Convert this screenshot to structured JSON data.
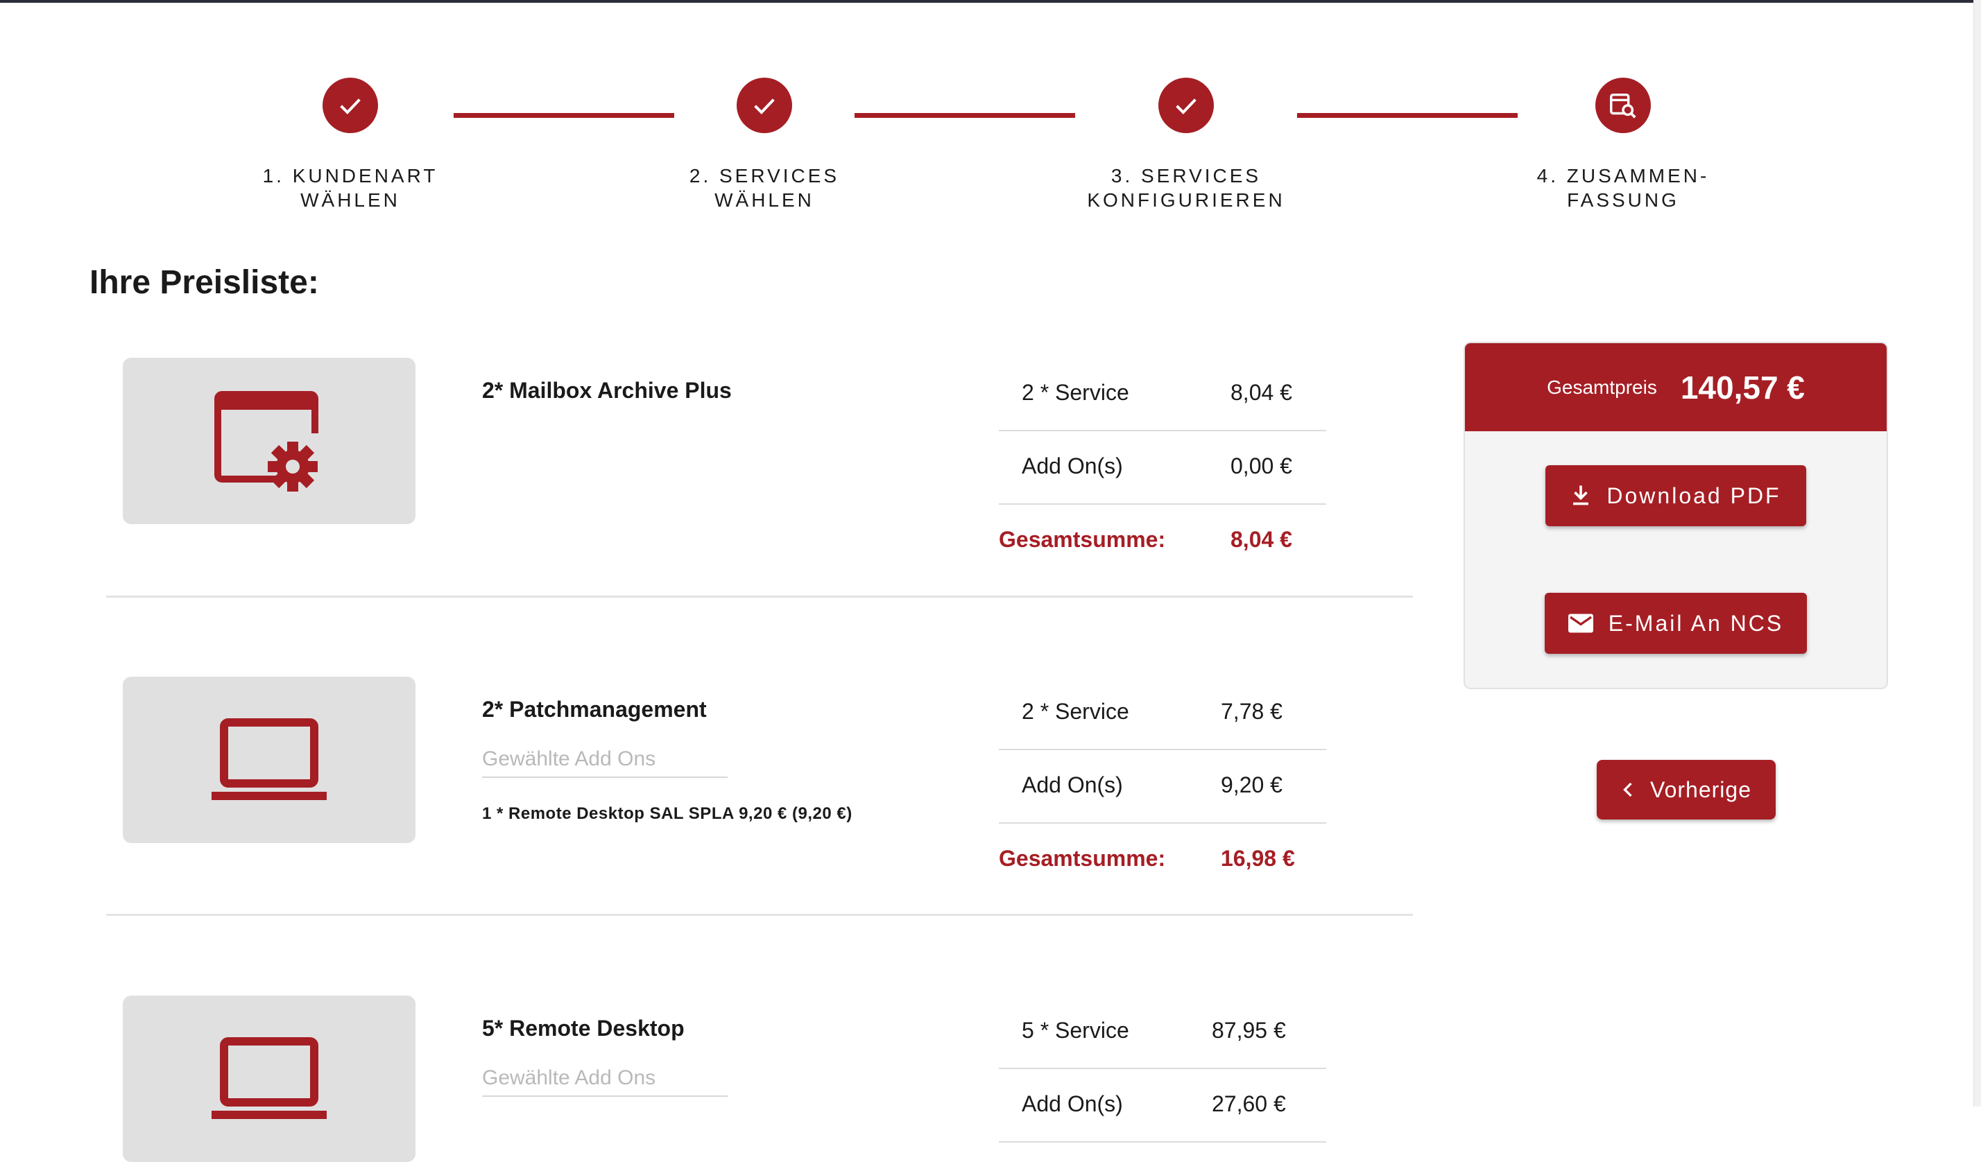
{
  "stepper": {
    "steps": [
      {
        "line1": "1. Kundenart",
        "line2": "wählen",
        "icon": "check-icon"
      },
      {
        "line1": "2. Services",
        "line2": "wählen",
        "icon": "check-icon"
      },
      {
        "line1": "3. Services",
        "line2": "konfigurieren",
        "icon": "check-icon"
      },
      {
        "line1": "4. Zusammen-",
        "line2": "fassung",
        "icon": "summary-search-icon"
      }
    ]
  },
  "page_title": "Ihre Preisliste:",
  "services": [
    {
      "title": "2* Mailbox Archive Plus",
      "icon": "window-settings-icon",
      "service_label": "2 * Service",
      "service_price": "8,04 €",
      "addon_label": "Add On(s)",
      "addon_price": "0,00 €",
      "total_label": "Gesamtsumme:",
      "total_price": "8,04 €"
    },
    {
      "title": "2* Patchmanagement",
      "icon": "laptop-icon",
      "addons_placeholder": "Gewählte Add Ons",
      "addon_detail": "1 * Remote Desktop SAL SPLA 9,20 € (9,20 €)",
      "service_label": "2 * Service",
      "service_price": "7,78 €",
      "addon_label": "Add On(s)",
      "addon_price": "9,20 €",
      "total_label": "Gesamtsumme:",
      "total_price": "16,98 €"
    },
    {
      "title": "5* Remote Desktop",
      "icon": "laptop-icon",
      "addons_placeholder": "Gewählte Add Ons",
      "service_label": "5 * Service",
      "service_price": "87,95 €",
      "addon_label": "Add On(s)",
      "addon_price": "27,60 €"
    }
  ],
  "summary": {
    "total_label": "Gesamtpreis",
    "total_value": "140,57 €",
    "download_label": "Download PDF",
    "download_icon": "download-icon",
    "email_label": "E-Mail An NCS",
    "email_icon": "mail-icon"
  },
  "nav": {
    "prev_label": "Vorherige",
    "prev_icon": "chevron-left-icon"
  },
  "colors": {
    "accent": "#a51e24",
    "thumb_bg": "#e0e0e0",
    "card_bg": "#f4f4f4"
  }
}
